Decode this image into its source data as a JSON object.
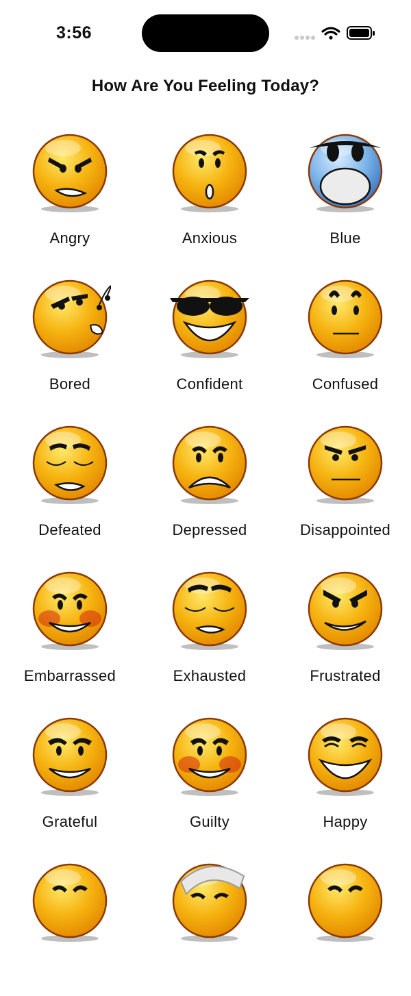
{
  "status": {
    "time": "3:56",
    "icons": [
      "signal-dots-icon",
      "wifi-icon",
      "battery-icon"
    ]
  },
  "header": {
    "title": "How Are You Feeling Today?"
  },
  "colors": {
    "face_fill": "#f6b411",
    "face_outline": "#8a3a06",
    "blue_face": "#7fb6ea",
    "text": "#111111"
  },
  "moods": [
    {
      "label": "Angry",
      "face": "angry",
      "icon": "angry-face-icon"
    },
    {
      "label": "Anxious",
      "face": "anxious",
      "icon": "anxious-face-icon"
    },
    {
      "label": "Blue",
      "face": "blue",
      "icon": "blue-face-icon"
    },
    {
      "label": "Bored",
      "face": "bored",
      "icon": "bored-face-icon"
    },
    {
      "label": "Confident",
      "face": "confident",
      "icon": "confident-face-icon"
    },
    {
      "label": "Confused",
      "face": "confused",
      "icon": "confused-face-icon"
    },
    {
      "label": "Defeated",
      "face": "defeated",
      "icon": "defeated-face-icon"
    },
    {
      "label": "Depressed",
      "face": "depressed",
      "icon": "depressed-face-icon"
    },
    {
      "label": "Disappointed",
      "face": "disappointed",
      "icon": "disappointed-face-icon"
    },
    {
      "label": "Embarrassed",
      "face": "embarrassed",
      "icon": "embarrassed-face-icon"
    },
    {
      "label": "Exhausted",
      "face": "exhausted",
      "icon": "exhausted-face-icon"
    },
    {
      "label": "Frustrated",
      "face": "frustrated",
      "icon": "frustrated-face-icon"
    },
    {
      "label": "Grateful",
      "face": "grateful",
      "icon": "grateful-face-icon"
    },
    {
      "label": "Guilty",
      "face": "guilty",
      "icon": "guilty-face-icon"
    },
    {
      "label": "Happy",
      "face": "happy",
      "icon": "happy-face-icon"
    },
    {
      "label": "",
      "face": "partial",
      "icon": "mood-face-icon"
    },
    {
      "label": "",
      "face": "bandaged",
      "icon": "bandaged-face-icon"
    },
    {
      "label": "",
      "face": "partial",
      "icon": "mood-face-icon"
    }
  ]
}
